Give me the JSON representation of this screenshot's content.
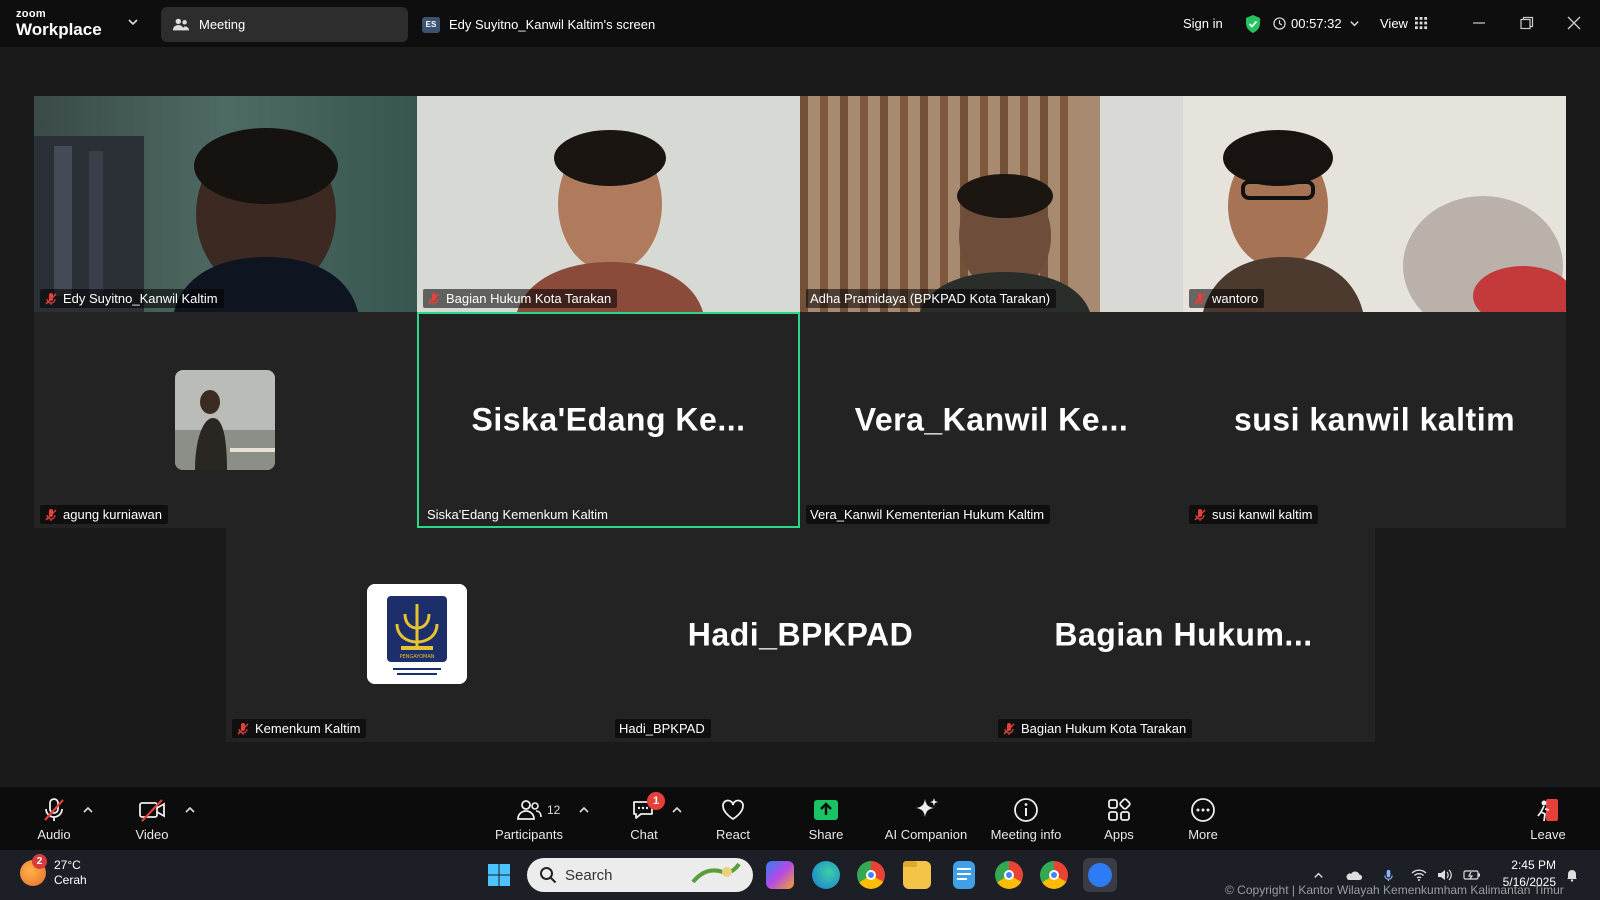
{
  "app": {
    "brand_top": "zoom",
    "brand_bottom": "Workplace"
  },
  "tabs": [
    {
      "label": "Meeting"
    },
    {
      "badge": "ES",
      "label": "Edy Suyitno_Kanwil Kaltim's screen"
    }
  ],
  "header": {
    "signin": "Sign in",
    "timer": "00:57:32",
    "view": "View"
  },
  "participants_grid": [
    {
      "name": "Edy Suyitno_Kanwil Kaltim",
      "muted": true,
      "video": "photo"
    },
    {
      "name": "Bagian Hukum Kota Tarakan",
      "muted": true,
      "video": "photo"
    },
    {
      "name": "Adha Pramidaya (BPKPAD Kota Tarakan)",
      "muted": false,
      "video": "photo"
    },
    {
      "name": "wantoro",
      "muted": true,
      "video": "photo"
    },
    {
      "name": "agung kurniawan",
      "muted": true,
      "video": "avatar"
    },
    {
      "name": "Siska'Edang Kemenkum Kaltim",
      "display": "Siska'Edang  Ke...",
      "muted": false,
      "active_speaker": true
    },
    {
      "name": "Vera_Kanwil Kementerian Hukum Kaltim",
      "display": "Vera_Kanwil  Ke...",
      "muted": false
    },
    {
      "name": "susi kanwil kaltim",
      "display": "susi kanwil kaltim",
      "muted": true
    },
    {
      "name": "Kemenkum Kaltim",
      "muted": true,
      "video": "logo",
      "logo_text": "PENGAYOMAN"
    },
    {
      "name": "Hadi_BPKPAD",
      "display": "Hadi_BPKPAD",
      "muted": false
    },
    {
      "name": "Bagian Hukum Kota Tarakan",
      "display": "Bagian  Hukum...",
      "muted": true
    }
  ],
  "toolbar": {
    "audio": "Audio",
    "video": "Video",
    "participants": "Participants",
    "participants_count": "12",
    "chat": "Chat",
    "chat_badge": "1",
    "react": "React",
    "share": "Share",
    "ai_companion": "AI Companion",
    "meeting_info": "Meeting info",
    "apps": "Apps",
    "more": "More",
    "leave": "Leave"
  },
  "taskbar": {
    "weather_temp": "27°C",
    "weather_desc": "Cerah",
    "weather_badge": "2",
    "search_placeholder": "Search",
    "time": "2:45 PM",
    "date": "5/16/2025",
    "copyright": "© Copyright | Kantor Wilayah Kemenkumham Kalimantan Timur"
  },
  "colors": {
    "active_border": "#2bd78a",
    "share_green": "#18c464",
    "muted_red": "#e5403a"
  }
}
